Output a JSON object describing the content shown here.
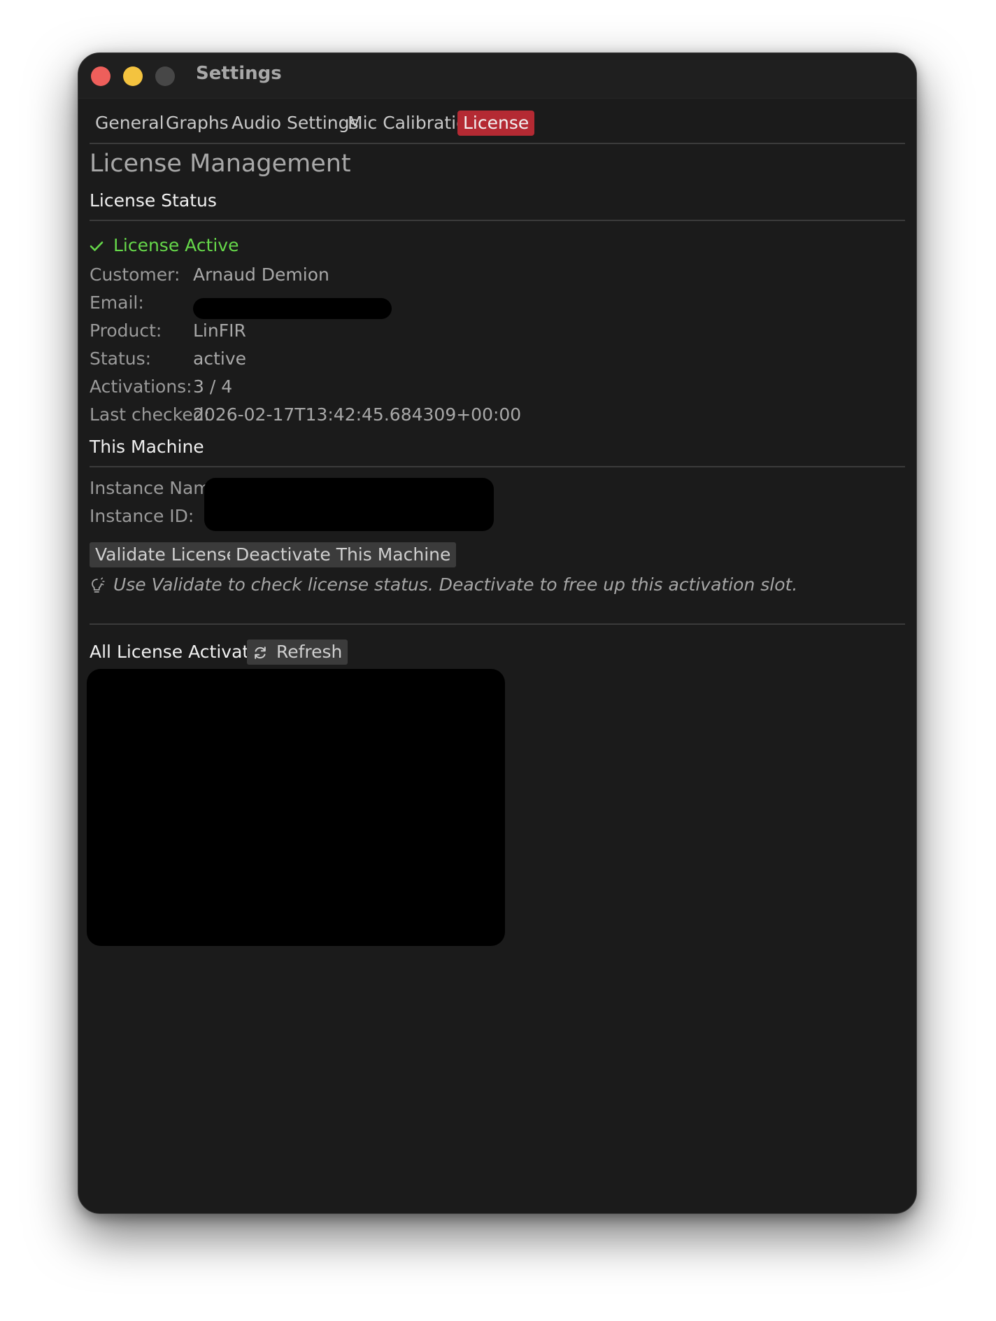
{
  "window": {
    "title": "Settings"
  },
  "tabs": [
    {
      "label": "General"
    },
    {
      "label": "Graphs"
    },
    {
      "label": "Audio Settings"
    },
    {
      "label": "Mic Calibration"
    },
    {
      "label": "License",
      "active": true
    }
  ],
  "license": {
    "heading": "License Management",
    "status_section": "License Status",
    "status_indicator": "License Active",
    "fields": [
      {
        "label": "Customer:",
        "value": "Arnaud Demion"
      },
      {
        "label": "Email:",
        "value": ""
      },
      {
        "label": "Product:",
        "value": "LinFIR"
      },
      {
        "label": "Status:",
        "value": "active"
      },
      {
        "label": "Activations:",
        "value": "3 / 4"
      },
      {
        "label": "Last checked:",
        "value": "2026-02-17T13:42:45.684309+00:00"
      }
    ]
  },
  "machine": {
    "section": "This Machine",
    "instance_name_label": "Instance Name:",
    "instance_id_label": "Instance ID:",
    "validate_label": "Validate License",
    "deactivate_label": "Deactivate This Machine",
    "hint": "Use Validate to check license status. Deactivate to free up this activation slot."
  },
  "activations": {
    "section": "All License Activations",
    "refresh_label": "Refresh"
  },
  "colors": {
    "accent_tab": "#b42a33",
    "success": "#66d84a",
    "background": "#1b1b1b"
  },
  "icons": {
    "status": "checkmark-icon",
    "hint": "lightbulb-icon",
    "refresh": "refresh-icon"
  }
}
